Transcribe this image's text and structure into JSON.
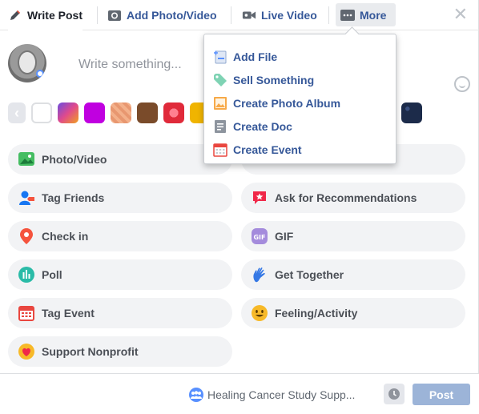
{
  "tabs": [
    {
      "label": "Write Post"
    },
    {
      "label": "Add Photo/Video"
    },
    {
      "label": "Live Video"
    },
    {
      "label": "More"
    }
  ],
  "composer": {
    "placeholder": "Write something..."
  },
  "palette_colors": [
    "#f2f3f5",
    "#6a4ce0",
    "#c000e0",
    "#f3b08a",
    "#7a4b2a",
    "#f0404f",
    "#f0b400",
    "#e02a2a",
    "#1c2b4a"
  ],
  "dropdown": [
    {
      "label": "Add File",
      "icon": "add-file-icon"
    },
    {
      "label": "Sell Something",
      "icon": "tag-icon"
    },
    {
      "label": "Create Photo Album",
      "icon": "photo-album-icon"
    },
    {
      "label": "Create Doc",
      "icon": "doc-icon"
    },
    {
      "label": "Create Event",
      "icon": "calendar-icon"
    }
  ],
  "actions": [
    {
      "label": "Photo/Video",
      "icon": "photo-icon",
      "color": "#45bd62"
    },
    {
      "label": "Tag Friends",
      "icon": "tag-friends-icon",
      "color": "#1877f2"
    },
    {
      "label": "Ask for Recommendations",
      "icon": "recommendation-icon",
      "color": "#f02849"
    },
    {
      "label": "Check in",
      "icon": "location-pin-icon",
      "color": "#f5533d"
    },
    {
      "label": "GIF",
      "icon": "gif-icon",
      "color": "#a48bdc"
    },
    {
      "label": "Poll",
      "icon": "poll-icon",
      "color": "#2abba7"
    },
    {
      "label": "Get Together",
      "icon": "wave-hand-icon",
      "color": "#3578e5"
    },
    {
      "label": "Tag Event",
      "icon": "calendar-icon",
      "color": "#e9463f"
    },
    {
      "label": "Feeling/Activity",
      "icon": "smiley-icon",
      "color": "#f7b928"
    },
    {
      "label": "Support Nonprofit",
      "icon": "heart-icon",
      "color": "#f02849"
    }
  ],
  "footer": {
    "group_label": "Healing Cancer Study Supp...",
    "post_label": "Post"
  },
  "colors": {
    "accent": "#365899",
    "post_disabled": "#9cb4d8"
  }
}
